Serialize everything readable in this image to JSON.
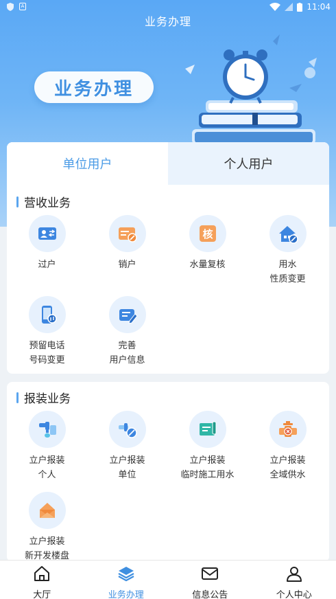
{
  "status_bar": {
    "time": "11:04",
    "badge": "A"
  },
  "header": {
    "title": "业务办理"
  },
  "hero": {
    "banner_text": "业务办理"
  },
  "tabs": [
    {
      "label": "单位用户",
      "active": true
    },
    {
      "label": "个人用户",
      "active": false
    }
  ],
  "sections": {
    "revenue": {
      "title": "营收业务",
      "items": [
        {
          "line1": "过户",
          "line2": "",
          "icon": "transfer-icon"
        },
        {
          "line1": "销户",
          "line2": "",
          "icon": "cancel-account-icon"
        },
        {
          "line1": "水量复核",
          "line2": "",
          "icon": "verify-icon",
          "glyph": "核"
        },
        {
          "line1": "用水",
          "line2": "性质变更",
          "icon": "house-change-icon"
        },
        {
          "line1": "预留电话",
          "line2": "号码变更",
          "icon": "phone-change-icon"
        },
        {
          "line1": "完善",
          "line2": "用户信息",
          "icon": "user-info-icon"
        }
      ]
    },
    "install": {
      "title": "报装业务",
      "items": [
        {
          "line1": "立户报装",
          "line2": "个人",
          "icon": "faucet-icon"
        },
        {
          "line1": "立户报装",
          "line2": "单位",
          "icon": "pipe-cancel-icon"
        },
        {
          "line1": "立户报装",
          "line2": "临时施工用水",
          "icon": "document-icon"
        },
        {
          "line1": "立户报装",
          "line2": "全域供水",
          "icon": "valve-icon"
        },
        {
          "line1": "立户报装",
          "line2": "新开发楼盘",
          "icon": "envelope-icon"
        }
      ]
    }
  },
  "bottom_nav": [
    {
      "label": "大厅",
      "icon": "home-icon",
      "active": false
    },
    {
      "label": "业务办理",
      "icon": "layers-icon",
      "active": true
    },
    {
      "label": "信息公告",
      "icon": "mail-icon",
      "active": false
    },
    {
      "label": "个人中心",
      "icon": "user-icon",
      "active": false
    }
  ],
  "colors": {
    "primary": "#4a9be6",
    "icon_bg": "#e7f1fd",
    "accent_orange": "#f5a05a"
  }
}
